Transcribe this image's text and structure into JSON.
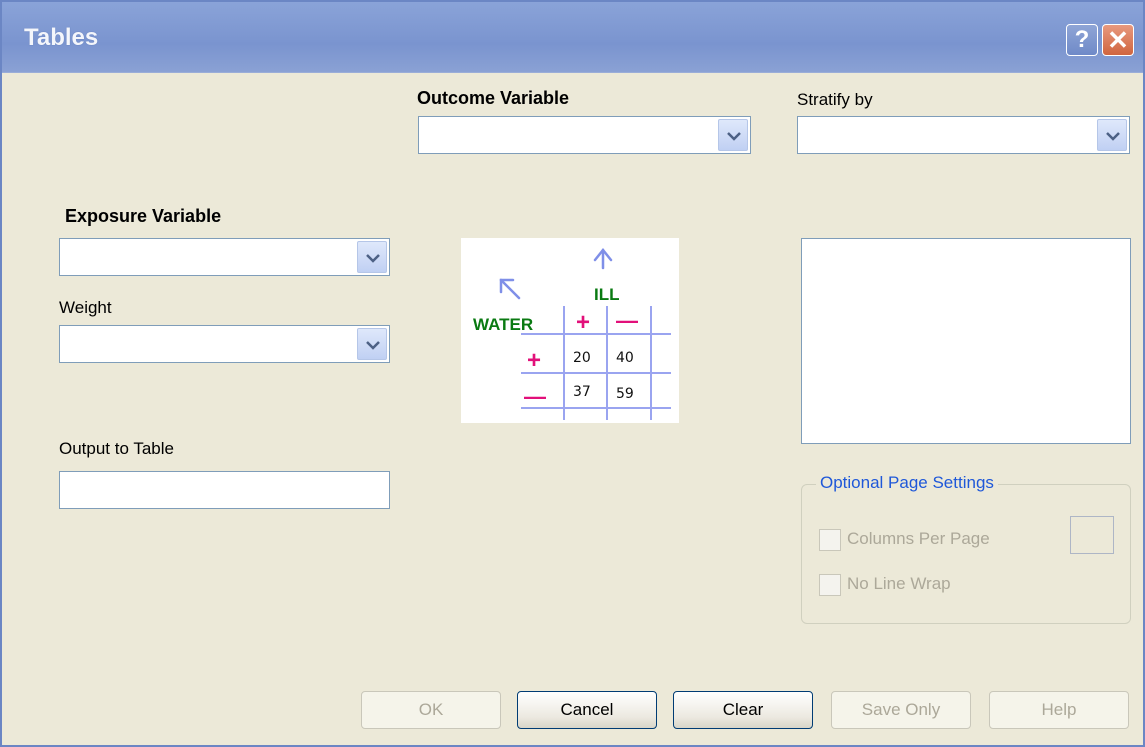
{
  "window": {
    "title": "Tables"
  },
  "titlebar": {
    "help_glyph": "?",
    "close_glyph": "✕"
  },
  "outcome": {
    "label": "Outcome Variable",
    "value": ""
  },
  "stratify": {
    "label": "Stratify by",
    "value": ""
  },
  "exposure": {
    "label": "Exposure Variable",
    "value": ""
  },
  "weight": {
    "label": "Weight",
    "value": ""
  },
  "output": {
    "label": "Output to Table",
    "value": ""
  },
  "illustration": {
    "column_header": "ILL",
    "row_header": "WATER",
    "plus": "+",
    "minus": "—",
    "cells": [
      [
        "20",
        "40"
      ],
      [
        "37",
        "59"
      ]
    ],
    "colors": {
      "arrow": "#7f8fe8",
      "header": "#0a7a12",
      "sign": "#e2107a",
      "grid": "#9aa4f0"
    }
  },
  "optional": {
    "legend": "Optional Page Settings",
    "columns_per_page": "Columns Per Page",
    "no_line_wrap": "No Line Wrap"
  },
  "buttons": {
    "ok": "OK",
    "cancel": "Cancel",
    "clear": "Clear",
    "save_only": "Save Only",
    "help": "Help"
  },
  "icons": [
    "help-icon",
    "close-icon",
    "chevron-down-icon"
  ]
}
